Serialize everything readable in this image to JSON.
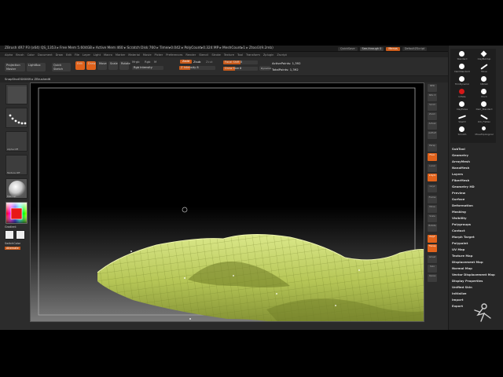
{
  "window": {
    "title": "ZBrush 4R7 P3 (x64)   QS_1353   ▸ Free Mem 5.604GB ▸ Active Mem 460 ▸ Scratch Disk 760 ▸ Timer▸0.042 ▸ PolyCount▸0.324 MP ▸ MeshCount▸1 ▸ Ztool3(9.2mb)",
    "right_buttons": [
      "QuickSave",
      "See-through 0",
      "Menus",
      "DefaultZScript"
    ]
  },
  "menubar": [
    "Alpha",
    "Brush",
    "Color",
    "Document",
    "Draw",
    "Edit",
    "File",
    "Layer",
    "Light",
    "Macro",
    "Marker",
    "Material",
    "Movie",
    "Picker",
    "Preferences",
    "Render",
    "Stencil",
    "Stroke",
    "Texture",
    "Tool",
    "Transform",
    "Zplugin",
    "Zscript"
  ],
  "toolbar": {
    "projection_master": "Projection Master",
    "lightbox": "LightBox",
    "quick_sketch": "Quick Sketch",
    "edit": "Edit",
    "draw": "Draw",
    "move": "Move",
    "scale": "Scale",
    "rotate": "Rotate",
    "mrgb": "Mrgb",
    "rgb": "Rgb",
    "m": "M",
    "zadd": "Zadd",
    "zsub": "Zsub",
    "zcut": "Zcut",
    "rgb_intensity": "Rgb Intensity",
    "z_intensity": "Z Intensity 8",
    "focal_shift": "Focal Shift 0",
    "draw_size": "Draw Size 8",
    "focal_shift_level": 0.5,
    "draw_size_level": 0.35,
    "z_intensity_level": 0.3,
    "dynamic": "Dynamic",
    "active_points": "ActivePoints: 1,392",
    "total_points": "TotalPoints: 1,392"
  },
  "docline": "SnapShot3D0069 ▸ ZBrushed6",
  "left_shelf": {
    "alpha_label": "Alpha Off",
    "texture_label": "Texture Off",
    "material_label": "MatCap",
    "gradient_label": "Gradient",
    "switch_color_label": "SwitchColor",
    "alternate_label": "Alternate"
  },
  "right_shelf": [
    "BPR",
    "SPix 3",
    "Scroll",
    "Zoom",
    "Actual",
    "AAHalf",
    "Persp",
    "Floor",
    "Local",
    "L.Sym",
    "Gxyz",
    "Frame",
    "Move",
    "Scale",
    "Rotate",
    "PolyF",
    "Transp",
    "Ghost",
    "Solo",
    "Xpose"
  ],
  "tray": {
    "brushes": [
      "Standard",
      "ClayBuildup",
      "DamStandard",
      "Move",
      "TrimDynamic",
      "hPolish",
      "Inflate",
      "Pinch",
      "ClayTubes",
      "Dam_Standard",
      "Slash3",
      "Orb_Flatten",
      "Smooth",
      "MoveTopological"
    ],
    "menus": [
      "SubTool",
      "Geometry",
      "ArrayMesh",
      "NanoMesh",
      "Layers",
      "FiberMesh",
      "Geometry HD",
      "Preview",
      "Surface",
      "Deformation",
      "Masking",
      "Visibility",
      "Polygroups",
      "Contact",
      "Morph Target",
      "Polypaint",
      "UV Map",
      "Texture Map",
      "Displacement Map",
      "Normal Map",
      "Vector Displacement Map",
      "Display Properties",
      "Unified Skin",
      "Initialize",
      "Import",
      "Export"
    ]
  },
  "colors": {
    "accent": "#e0621b",
    "mesh": "#c4d468",
    "mesh_shadow": "#6d7a25"
  }
}
